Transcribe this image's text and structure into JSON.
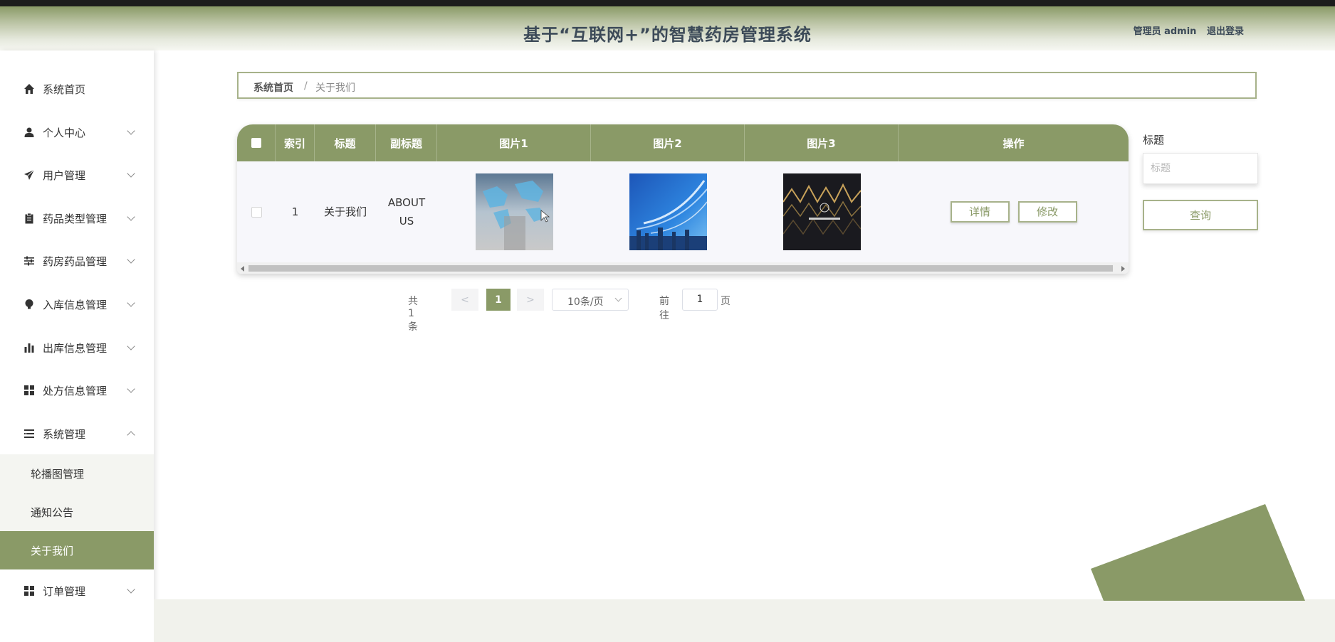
{
  "header": {
    "title": "基于“互联网+”的智慧药房管理系统",
    "role": "管理员 admin",
    "logout": "退出登录"
  },
  "sidebar": {
    "items": [
      {
        "label": "系统首页",
        "icon": "home-icon"
      },
      {
        "label": "个人中心",
        "icon": "user-icon"
      },
      {
        "label": "用户管理",
        "icon": "send-icon"
      },
      {
        "label": "药品类型管理",
        "icon": "clipboard-icon"
      },
      {
        "label": "药房药品管理",
        "icon": "sliders-icon"
      },
      {
        "label": "入库信息管理",
        "icon": "bulb-icon"
      },
      {
        "label": "出库信息管理",
        "icon": "bar-chart-icon"
      },
      {
        "label": "处方信息管理",
        "icon": "grid-icon"
      },
      {
        "label": "系统管理",
        "icon": "list-icon"
      },
      {
        "label": "订单管理",
        "icon": "grid-icon"
      }
    ],
    "sub_items": [
      {
        "label": "轮播图管理"
      },
      {
        "label": "通知公告"
      },
      {
        "label": "关于我们"
      }
    ]
  },
  "breadcrumb": {
    "home": "系统首页",
    "separator": "/",
    "current": "关于我们"
  },
  "table": {
    "columns": [
      "索引",
      "标题",
      "副标题",
      "图片1",
      "图片2",
      "图片3",
      "操作"
    ],
    "rows": [
      {
        "index": "1",
        "title": "关于我们",
        "subtitle": "ABOUT US",
        "detail": "详情",
        "edit": "修改"
      }
    ]
  },
  "pagination": {
    "total": "共 1 条",
    "prev": "<",
    "page": "1",
    "next": ">",
    "page_size": "10条/页",
    "goto_label": "前往",
    "goto_value": "1",
    "page_suffix": "页"
  },
  "search": {
    "label": "标题",
    "placeholder": "标题",
    "button": "查询"
  },
  "colors": {
    "accent": "#8a9a67",
    "accent_light": "#a7b28a"
  }
}
